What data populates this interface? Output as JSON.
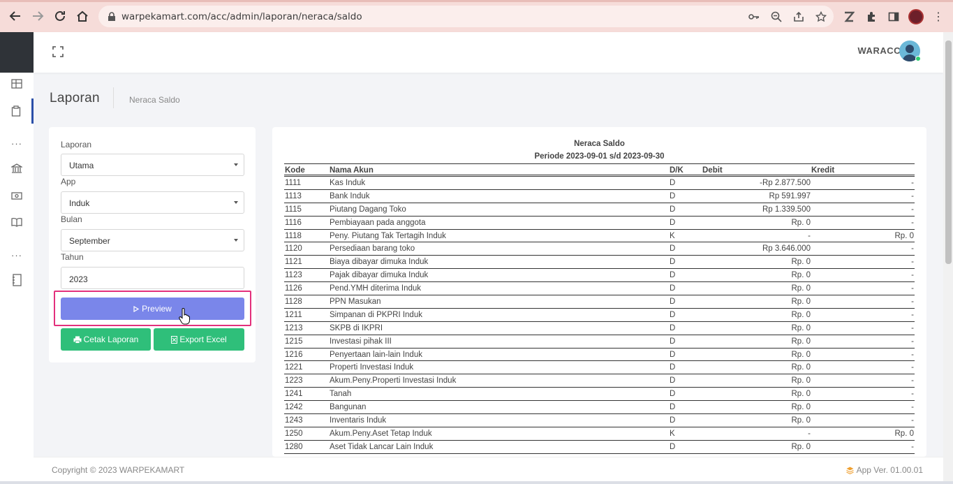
{
  "browser": {
    "url": "warpekamart.com/acc/admin/laporan/neraca/saldo"
  },
  "header": {
    "brand": "WARACC"
  },
  "breadcrumb": {
    "title": "Laporan",
    "current": "Neraca Saldo"
  },
  "form": {
    "laporan_label": "Laporan",
    "laporan_value": "Utama",
    "app_label": "App",
    "app_value": "Induk",
    "bulan_label": "Bulan",
    "bulan_value": "September",
    "tahun_label": "Tahun",
    "tahun_value": "2023",
    "preview_label": "Preview",
    "cetak_label": "Cetak Laporan",
    "export_label": "Export Excel"
  },
  "report": {
    "title": "Neraca Saldo",
    "period": "Periode 2023-09-01 s/d 2023-09-30",
    "columns": {
      "kode": "Kode",
      "nama": "Nama Akun",
      "dk": "D/K",
      "debit": "Debit",
      "kredit": "Kredit"
    },
    "rows": [
      {
        "kode": "1111",
        "nama": "Kas Induk",
        "dk": "D",
        "debit": "-Rp 2.877.500",
        "kredit": "-"
      },
      {
        "kode": "1113",
        "nama": "Bank Induk",
        "dk": "D",
        "debit": "Rp 591.997",
        "kredit": "-"
      },
      {
        "kode": "1115",
        "nama": "Piutang Dagang Toko",
        "dk": "D",
        "debit": "Rp 1.339.500",
        "kredit": "-"
      },
      {
        "kode": "1116",
        "nama": "Pembiayaan pada anggota",
        "dk": "D",
        "debit": "Rp. 0",
        "kredit": "-"
      },
      {
        "kode": "1118",
        "nama": "Peny. Piutang Tak Tertagih Induk",
        "dk": "K",
        "debit": "-",
        "kredit": "Rp. 0"
      },
      {
        "kode": "1120",
        "nama": "Persediaan barang toko",
        "dk": "D",
        "debit": "Rp 3.646.000",
        "kredit": "-"
      },
      {
        "kode": "1121",
        "nama": "Biaya dibayar dimuka Induk",
        "dk": "D",
        "debit": "Rp. 0",
        "kredit": "-"
      },
      {
        "kode": "1123",
        "nama": "Pajak dibayar dimuka Induk",
        "dk": "D",
        "debit": "Rp. 0",
        "kredit": "-"
      },
      {
        "kode": "1126",
        "nama": "Pend.YMH diterima Induk",
        "dk": "D",
        "debit": "Rp. 0",
        "kredit": "-"
      },
      {
        "kode": "1128",
        "nama": "PPN Masukan",
        "dk": "D",
        "debit": "Rp. 0",
        "kredit": "-"
      },
      {
        "kode": "1211",
        "nama": "Simpanan di PKPRI Induk",
        "dk": "D",
        "debit": "Rp. 0",
        "kredit": "-"
      },
      {
        "kode": "1213",
        "nama": "SKPB di IKPRI",
        "dk": "D",
        "debit": "Rp. 0",
        "kredit": "-"
      },
      {
        "kode": "1215",
        "nama": "Investasi pihak III",
        "dk": "D",
        "debit": "Rp. 0",
        "kredit": "-"
      },
      {
        "kode": "1216",
        "nama": "Penyertaan lain-lain Induk",
        "dk": "D",
        "debit": "Rp. 0",
        "kredit": "-"
      },
      {
        "kode": "1221",
        "nama": "Properti Investasi Induk",
        "dk": "D",
        "debit": "Rp. 0",
        "kredit": "-"
      },
      {
        "kode": "1223",
        "nama": "Akum.Peny.Properti Investasi Induk",
        "dk": "D",
        "debit": "Rp. 0",
        "kredit": "-"
      },
      {
        "kode": "1241",
        "nama": "Tanah",
        "dk": "D",
        "debit": "Rp. 0",
        "kredit": "-"
      },
      {
        "kode": "1242",
        "nama": "Bangunan",
        "dk": "D",
        "debit": "Rp. 0",
        "kredit": "-"
      },
      {
        "kode": "1243",
        "nama": "Inventaris Induk",
        "dk": "D",
        "debit": "Rp. 0",
        "kredit": "-"
      },
      {
        "kode": "1250",
        "nama": "Akum.Peny.Aset Tetap Induk",
        "dk": "K",
        "debit": "-",
        "kredit": "Rp. 0"
      },
      {
        "kode": "1280",
        "nama": "Aset Tidak Lancar Lain Induk",
        "dk": "D",
        "debit": "Rp. 0",
        "kredit": "-"
      }
    ]
  },
  "footer": {
    "copyright": "Copyright © 2023 WARPEKAMART",
    "version": "App Ver. 01.00.01"
  }
}
